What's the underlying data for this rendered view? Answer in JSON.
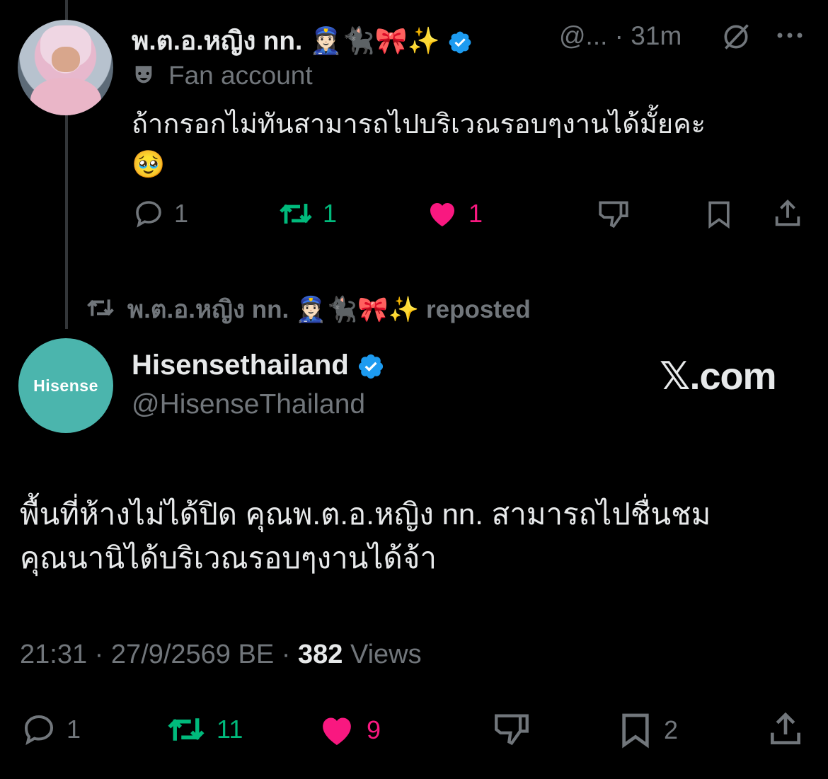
{
  "reply_tweet": {
    "display_name": "พ.ต.อ.หญิง nn.",
    "name_emojis": "👮🏻‍♀️🐈‍⬛🎀✨",
    "handle": "@...",
    "time": "31m",
    "label": "Fan account",
    "text": "ถ้ากรอกไม่ทันสามารถไปบริเวณรอบๆงานได้มั้ยคะ",
    "text_emoji": "🥹",
    "actions": {
      "replies": "1",
      "reposts": "1",
      "likes": "1"
    }
  },
  "repost_notice": {
    "name": "พ.ต.อ.หญิง nn.",
    "emojis": "👮🏻‍♀️🐈‍⬛🎀✨",
    "suffix": "reposted"
  },
  "main_tweet": {
    "avatar_text": "Hisense",
    "display_name": "Hisensethailand",
    "handle": "@HisenseThailand",
    "watermark_x": "𝕏",
    "watermark_domain": ".com",
    "text_line1": "พื้นที่ห้างไม่ได้ปิด คุณพ.ต.อ.หญิง nn. สามารถไปชื่นชม",
    "text_line2": "คุณนานิได้บริเวณรอบๆงานได้จ้า",
    "time": "21:31",
    "date": "27/9/2569 BE",
    "views_count": "382",
    "views_label": "Views",
    "actions": {
      "replies": "1",
      "reposts": "11",
      "likes": "9",
      "bookmarks": "2"
    }
  },
  "colors": {
    "verified": "#1d9bf0",
    "repost_green": "#00ba7c",
    "like_pink": "#f91880",
    "muted": "#71767b",
    "avatar_teal": "#4bb5ad"
  }
}
